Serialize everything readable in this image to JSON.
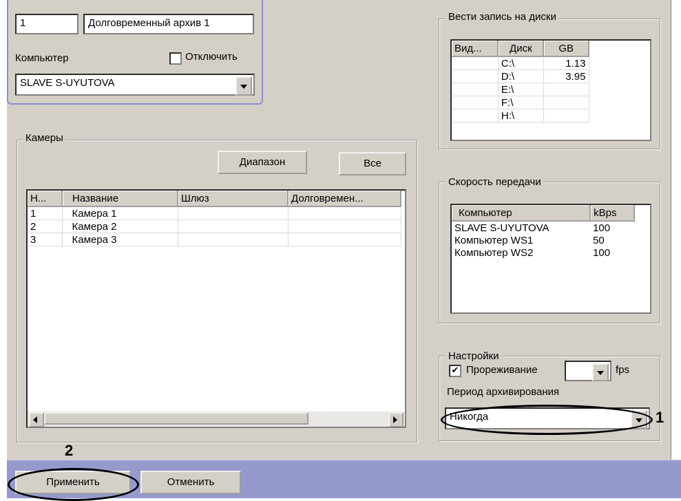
{
  "archive": {
    "id": "1",
    "name": "Долговременный архив 1"
  },
  "computer": {
    "label": "Компьютер",
    "disable_label": "Отключить",
    "disable_checked": false,
    "selected": "SLAVE S-UYUTOVA"
  },
  "disks": {
    "title": "Вести запись на диски",
    "headers": [
      "Вид...",
      "Диск",
      "GB"
    ],
    "rows": [
      [
        "",
        "C:\\",
        "1.13"
      ],
      [
        "",
        "D:\\",
        "3.95"
      ],
      [
        "",
        "E:\\",
        ""
      ],
      [
        "",
        "F:\\",
        ""
      ],
      [
        "",
        "H:\\",
        ""
      ]
    ]
  },
  "cameras": {
    "title": "Камеры",
    "range_button": "Диапазон",
    "all_button": "Все",
    "headers": [
      "Н...",
      "Название",
      "Шлюз",
      "Долговремен..."
    ],
    "rows": [
      [
        "1",
        "Камера 1",
        "",
        ""
      ],
      [
        "2",
        "Камера 2",
        "",
        ""
      ],
      [
        "3",
        "Камера 3",
        "",
        ""
      ]
    ]
  },
  "speed": {
    "title": "Скорость передачи",
    "headers": [
      "Компьютер",
      "kBps"
    ],
    "rows": [
      [
        "SLAVE S-UYUTOVA",
        "100"
      ],
      [
        "Компьютер WS1",
        "50"
      ],
      [
        "Компьютер WS2",
        "100"
      ]
    ]
  },
  "settings": {
    "title": "Настройки",
    "thinning_label": "Прореживание",
    "thinning_checked": true,
    "fps_value": "",
    "fps_unit": "fps",
    "period_label": "Период архивирования",
    "period_value": "Никогда"
  },
  "footer": {
    "apply": "Применить",
    "cancel": "Отменить"
  },
  "callouts": {
    "one": "1",
    "two": "2"
  },
  "colors": {
    "panel": "#d4d0c8",
    "top_panel_border": "#8a8fcf",
    "footer": "#9599cc"
  }
}
